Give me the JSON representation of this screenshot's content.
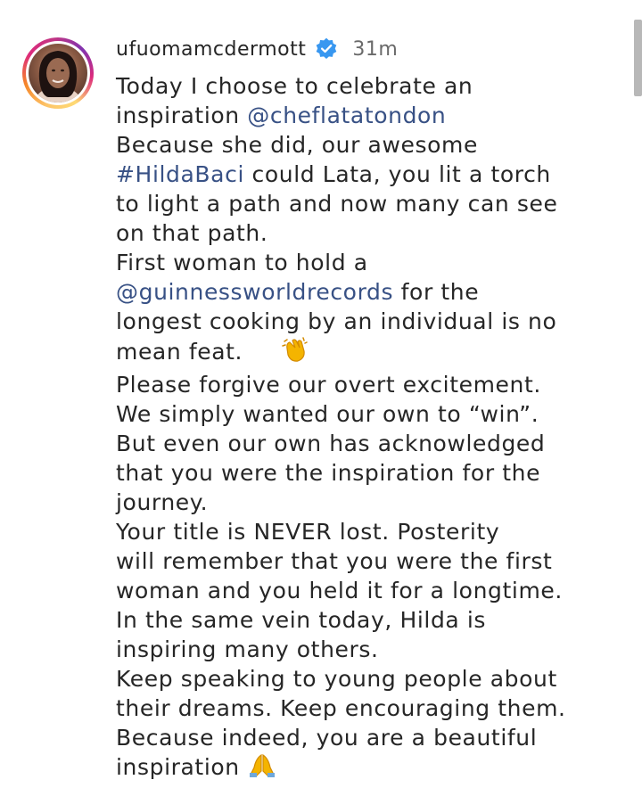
{
  "post": {
    "username": "ufuomamcdermott",
    "timestamp": "31m",
    "verified": true,
    "accent_link_color": "#385185",
    "verified_color": "#3897f0"
  },
  "caption": {
    "l1": "Today I choose to celebrate an",
    "l2_pre": "inspiration ",
    "l2_mention": "@cheflatatondon",
    "l3": "Because she did, our awesome",
    "l4_tag": "#HildaBaci",
    "l4_post": " could  Lata, you lit a torch",
    "l5": "to light a path and now many can see",
    "l6": "on that path.",
    "l7": "First woman to hold a",
    "l8_mention": "@guinnessworldrecords",
    "l8_post": " for the",
    "l9": "longest cooking by an individual is no",
    "l10": "mean feat.",
    "l10_emoji": "clapping-hands-emoji",
    "l11": "Please forgive our overt excitement.",
    "l12": "We simply wanted our own to “win”.",
    "l13": "But even our own has acknowledged",
    "l14": "that you were the inspiration for the",
    "l15": "journey.",
    "l16": "Your title is NEVER lost.  Posterity",
    "l17": "will remember that you were the first",
    "l18": "woman and you held it for a longtime.",
    "l19": "In the same vein today, Hilda is",
    "l20": "inspiring many others.",
    "l21": "Keep speaking to young people about",
    "l22": "their dreams. Keep encouraging them.",
    "l23": "Because indeed, you are a beautiful",
    "l24": "inspiration",
    "l24_emoji": "folded-hands-emoji"
  }
}
